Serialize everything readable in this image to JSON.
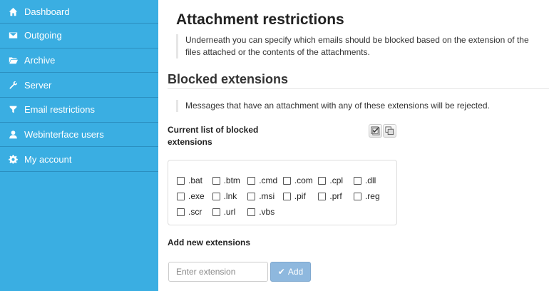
{
  "sidebar": {
    "items": [
      {
        "label": "Dashboard",
        "icon": "home-icon"
      },
      {
        "label": "Outgoing",
        "icon": "envelope-icon"
      },
      {
        "label": "Archive",
        "icon": "folder-icon"
      },
      {
        "label": "Server",
        "icon": "wrench-icon"
      },
      {
        "label": "Email restrictions",
        "icon": "filter-icon"
      },
      {
        "label": "Webinterface users",
        "icon": "user-icon"
      },
      {
        "label": "My account",
        "icon": "gear-icon"
      }
    ]
  },
  "main": {
    "title": "Attachment restrictions",
    "intro": "Underneath you can specify which emails should be blocked based on the extension of the files attached or the contents of the attachments.",
    "blocked": {
      "heading": "Blocked extensions",
      "note": "Messages that have an attachment with any of these extensions will be rejected.",
      "list_label": "Current list of blocked extensions",
      "extensions": [
        ".bat",
        ".btm",
        ".cmd",
        ".com",
        ".cpl",
        ".dll",
        ".exe",
        ".lnk",
        ".msi",
        ".pif",
        ".prf",
        ".reg",
        ".scr",
        ".url",
        ".vbs"
      ]
    },
    "add": {
      "label": "Add new extensions",
      "placeholder": "Enter extension",
      "button": "Add"
    }
  },
  "colors": {
    "sidebar": "#3aaee2",
    "add_button": "#8eb8de"
  }
}
